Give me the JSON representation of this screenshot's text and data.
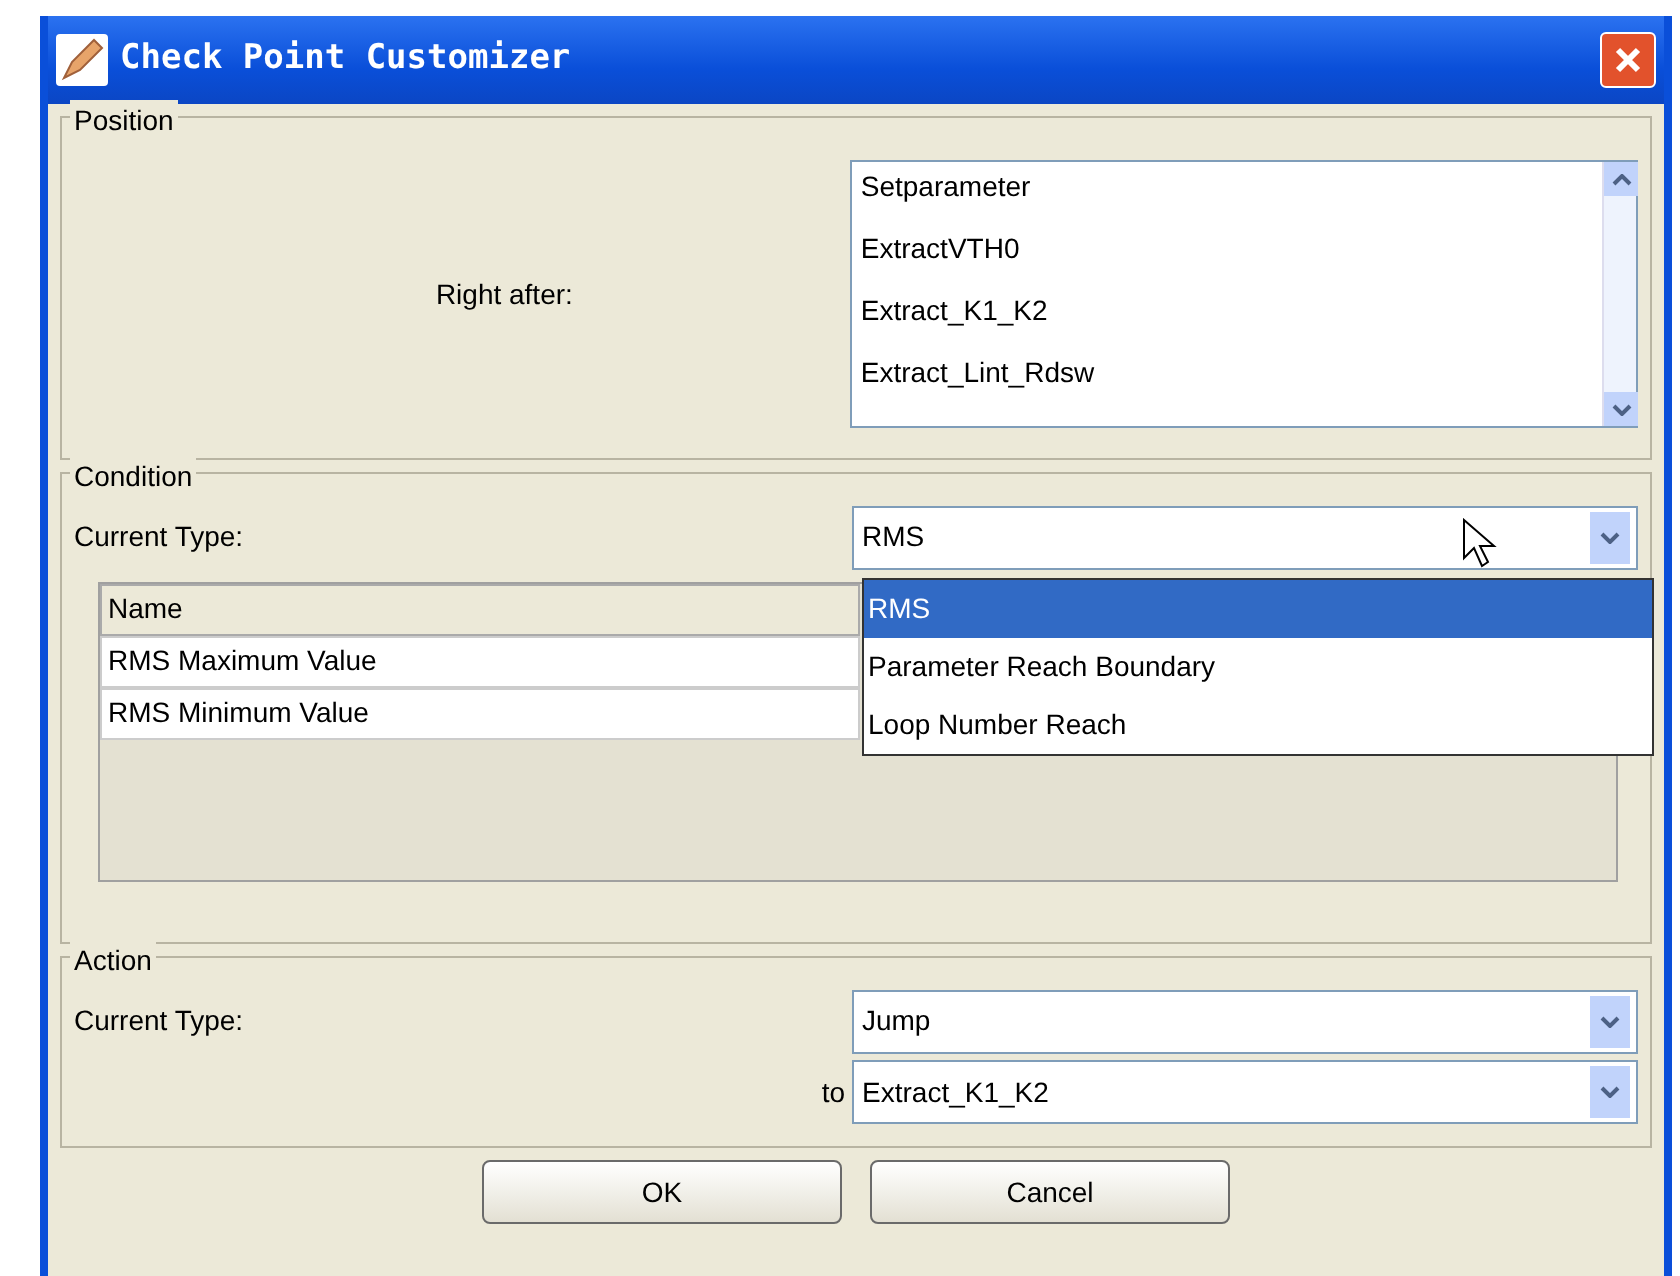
{
  "window": {
    "title": "Check Point Customizer"
  },
  "position": {
    "legend": "Position",
    "label": "Right after:",
    "list": [
      "Setparameter",
      "ExtractVTH0",
      "Extract_K1_K2",
      "Extract_Lint_Rdsw"
    ]
  },
  "condition": {
    "legend": "Condition",
    "type_label": "Current Type:",
    "type_value": "RMS",
    "expanded": true,
    "options": [
      {
        "text": "RMS",
        "selected": true
      },
      {
        "text": "Parameter Reach Boundary",
        "selected": false
      },
      {
        "text": "Loop Number Reach",
        "selected": false
      }
    ],
    "table": {
      "columns": [
        "Name"
      ],
      "rows": [
        [
          "RMS Maximum Value"
        ],
        [
          "RMS Minimum Value"
        ]
      ]
    }
  },
  "action": {
    "legend": "Action",
    "type_label": "Current Type:",
    "type_value": "Jump",
    "to_label": "to",
    "to_value": "Extract_K1_K2"
  },
  "buttons": [
    "OK",
    "Cancel"
  ]
}
